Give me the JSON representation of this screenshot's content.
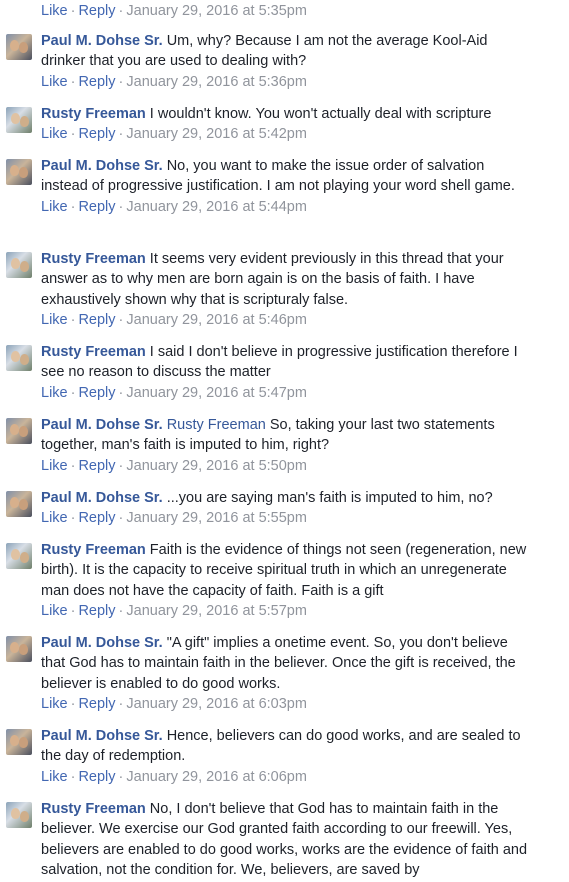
{
  "actions": {
    "like": "Like",
    "reply": "Reply"
  },
  "top_meta": {
    "timestamp": "January 29, 2016 at 5:35pm"
  },
  "comments": [
    {
      "author": "Paul M. Dohse Sr.",
      "mention": "",
      "text": "Um, why? Because I am not the average Kool-Aid drinker that you are used to dealing with?",
      "timestamp": "January 29, 2016 at 5:36pm",
      "avatar": "paul"
    },
    {
      "author": "Rusty Freeman",
      "mention": "",
      "text": "I wouldn't know. You won't actually deal with scripture",
      "timestamp": "January 29, 2016 at 5:42pm",
      "avatar": "rusty"
    },
    {
      "author": "Paul M. Dohse Sr.",
      "mention": "",
      "text": "No, you want to make the issue order of salvation instead of progressive justification. I am not playing your word shell game.",
      "timestamp": "January 29, 2016 at 5:44pm",
      "avatar": "paul"
    },
    {
      "author": "Rusty Freeman",
      "mention": "",
      "text": "It seems very evident previously in this thread that your answer as to why men are born again is on the basis of faith. I have exhaustively shown why that is scripturaly false.",
      "timestamp": "January 29, 2016 at 5:46pm",
      "avatar": "rusty"
    },
    {
      "author": "Rusty Freeman",
      "mention": "",
      "text": "I said I don't believe in progressive justification therefore I see no reason to discuss the matter",
      "timestamp": "January 29, 2016 at 5:47pm",
      "avatar": "rusty"
    },
    {
      "author": "Paul M. Dohse Sr.",
      "mention": "Rusty Freeman",
      "text": "So, taking your last two statements together, man's faith is imputed to him, right?",
      "timestamp": "January 29, 2016 at 5:50pm",
      "avatar": "paul"
    },
    {
      "author": "Paul M. Dohse Sr.",
      "mention": "",
      "text": "...you are saying man's faith is imputed to him, no?",
      "timestamp": "January 29, 2016 at 5:55pm",
      "avatar": "paul"
    },
    {
      "author": "Rusty Freeman",
      "mention": "",
      "text": "Faith is the evidence of things not seen (regeneration, new birth). It is the capacity to receive spiritual truth in which an unregenerate man does not have the capacity of faith. Faith is a gift",
      "timestamp": "January 29, 2016 at 5:57pm",
      "avatar": "rusty"
    },
    {
      "author": "Paul M. Dohse Sr.",
      "mention": "",
      "text": "\"A gift\" implies a onetime event. So, you don't believe that God has to maintain faith in the believer. Once the gift is received, the believer is enabled to do good works.",
      "timestamp": "January 29, 2016 at 6:03pm",
      "avatar": "paul"
    },
    {
      "author": "Paul M. Dohse Sr.",
      "mention": "",
      "text": "Hence, believers can do good works, and are sealed to the day of redemption.",
      "timestamp": "January 29, 2016 at 6:06pm",
      "avatar": "paul"
    },
    {
      "author": "Rusty Freeman",
      "mention": "",
      "text": "No, I don't believe that God has to maintain faith in the believer. We exercise our God granted faith according to our freewill. Yes, believers are enabled to do good works, works are the evidence of faith and salvation, not the condition for. We, believers, are saved by",
      "timestamp": "",
      "avatar": "rusty"
    }
  ]
}
